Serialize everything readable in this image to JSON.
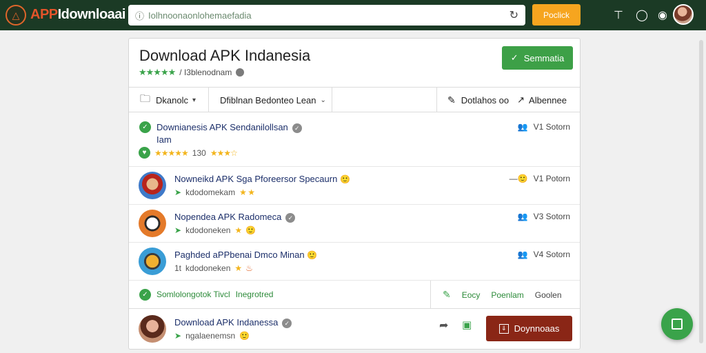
{
  "topbar": {
    "logo_app": "APP",
    "logo_rest": "Idownloaai",
    "url": "Iolhnoonaonlohemaefadia",
    "button_label": "Poclick"
  },
  "card": {
    "title": "Download APK Indanesia",
    "rating_text": "/ I3blenodnam",
    "header_button": "Semmatia",
    "filters": {
      "left": "Dkanolc",
      "middle": "Dfiblnan Bedonteo Lean",
      "right_a": "Dotlahos oo",
      "right_b": "Albennee"
    },
    "items": [
      {
        "title": "Downianesis APK Sendanilollsan",
        "title_line2": "Iam",
        "sub_rating": "130",
        "version": "V1 Sotorn"
      },
      {
        "title": "Nowneikd APK Sga Pforeersor Specaurn",
        "sub": "kdodomekam",
        "version": "V1 Potorn"
      },
      {
        "title": "Nopendea APK Radomeca",
        "sub": "kdodoneken",
        "version": "V3 Sotorn"
      },
      {
        "title": "Paghded aPPbenai Dmco Minan",
        "sub_prefix": "1t",
        "sub": "kdodoneken",
        "version": "V4 Sotorn"
      }
    ],
    "footer": {
      "status": "Somlolongotok Tivcl",
      "tag": "Inegrotred",
      "action_a": "Eocy",
      "action_b": "Poenlam",
      "action_c": "Goolen"
    },
    "bottom_item": {
      "title": "Download APK Indanessa",
      "sub": "ngalaenemsn",
      "button": "Doynnoaas"
    }
  },
  "colors": {
    "topbar": "#1b3a25",
    "accent_green": "#3aa34a",
    "orange": "#f6a51f",
    "download_button": "#8a2616"
  }
}
